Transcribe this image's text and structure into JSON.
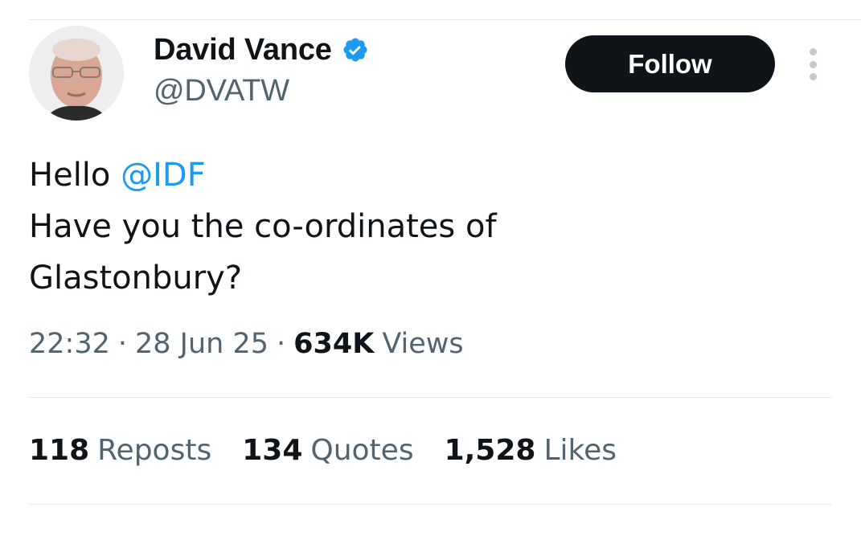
{
  "author": {
    "display_name": "David Vance",
    "handle": "@DVATW",
    "verified": true,
    "avatar_icon": "profile-photo"
  },
  "actions": {
    "follow_label": "Follow",
    "more_icon": "more-vertical-icon"
  },
  "tweet": {
    "greeting": "Hello ",
    "mention": "@IDF",
    "line2": "Have you the co-ordinates of",
    "line3": "Glastonbury?"
  },
  "meta": {
    "time": "22:32",
    "separator": "·",
    "date": "28 Jun 25",
    "views_count": "634K",
    "views_label": "Views"
  },
  "stats": [
    {
      "count": "118",
      "label": "Reposts"
    },
    {
      "count": "134",
      "label": "Quotes"
    },
    {
      "count": "1,528",
      "label": "Likes"
    }
  ],
  "colors": {
    "mention": "#1d9bf0",
    "verified": "#1d9bf0",
    "follow_bg": "#0f1419",
    "secondary_text": "#536471"
  }
}
